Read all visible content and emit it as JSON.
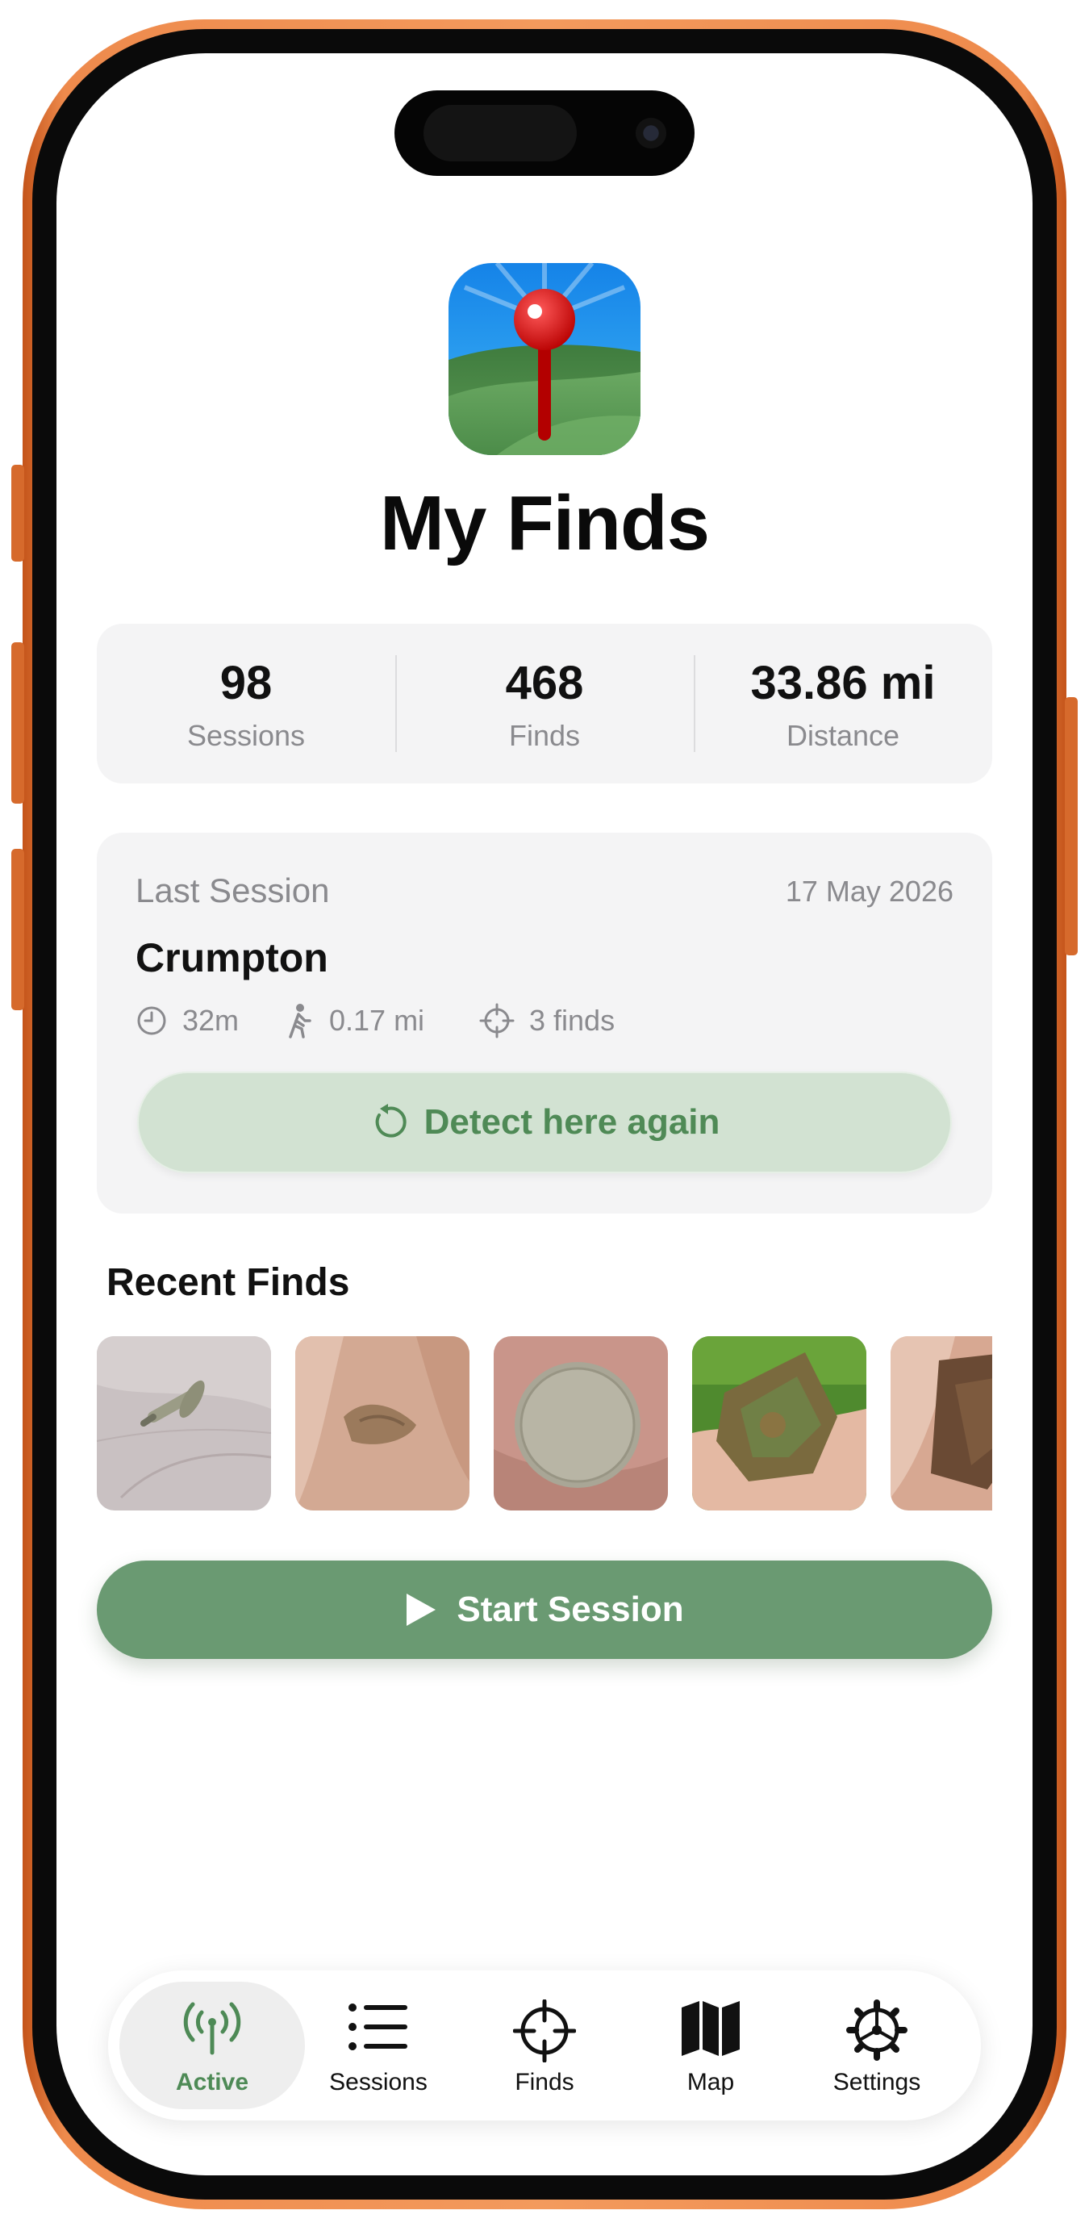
{
  "app": {
    "title": "My Finds",
    "accent_color": "#6a9a72",
    "icon": "map-pin-hills-icon"
  },
  "stats": [
    {
      "value": "98",
      "label": "Sessions"
    },
    {
      "value": "468",
      "label": "Finds"
    },
    {
      "value": "33.86 mi",
      "label": "Distance"
    }
  ],
  "last_session": {
    "label": "Last Session",
    "date": "17 May 2026",
    "place": "Crumpton",
    "duration": "32m",
    "distance": "0.17 mi",
    "finds": "3 finds",
    "action_label": "Detect here again"
  },
  "recent_finds": {
    "title": "Recent Finds",
    "items": [
      {
        "icon": "nail-find-photo"
      },
      {
        "icon": "fragment-find-photo"
      },
      {
        "icon": "coin-find-photo"
      },
      {
        "icon": "corroded-metal-find-photo"
      },
      {
        "icon": "rusty-fragment-find-photo"
      }
    ]
  },
  "start_button": {
    "label": "Start Session"
  },
  "tabbar": {
    "active": "Active",
    "tabs": [
      {
        "label": "Active",
        "icon": "antenna-icon"
      },
      {
        "label": "Sessions",
        "icon": "list-icon"
      },
      {
        "label": "Finds",
        "icon": "crosshair-icon"
      },
      {
        "label": "Map",
        "icon": "map-icon"
      },
      {
        "label": "Settings",
        "icon": "gear-icon"
      }
    ]
  }
}
